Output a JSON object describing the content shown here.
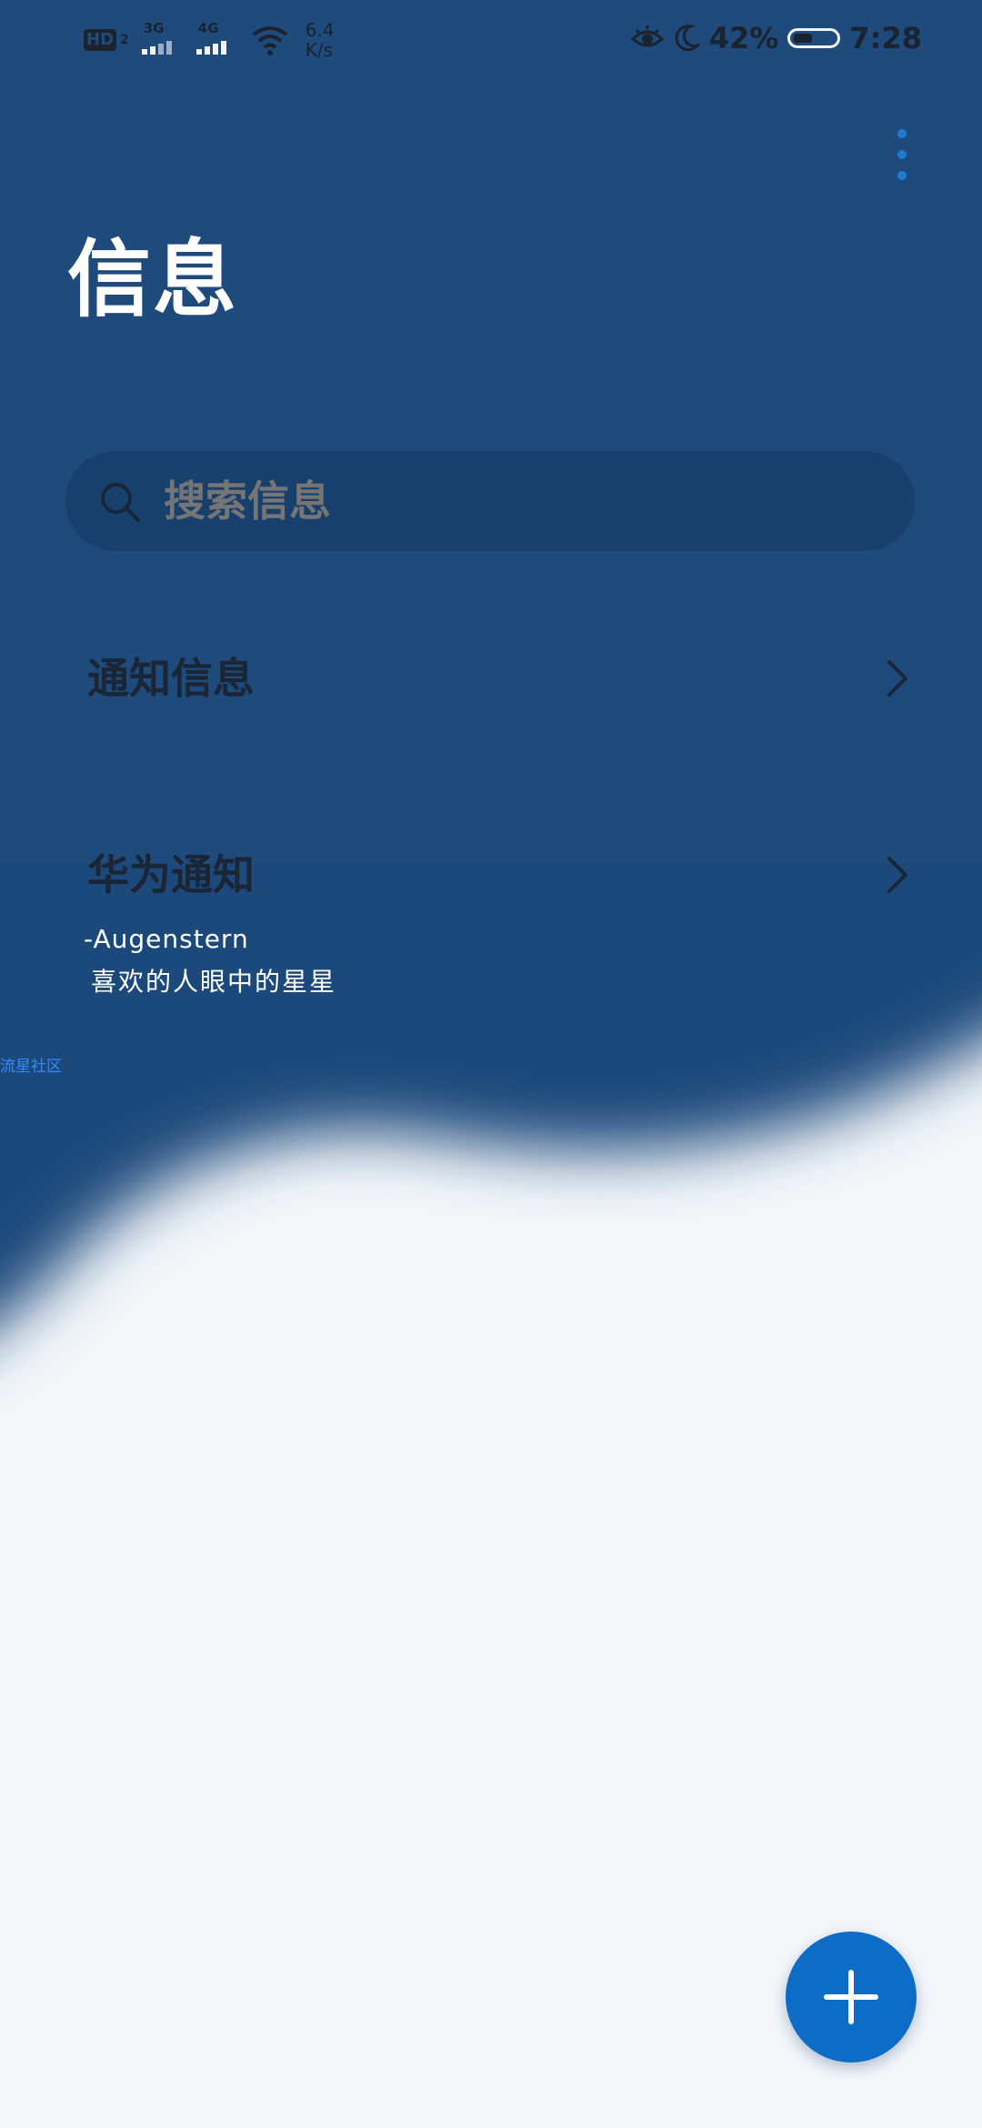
{
  "status_bar": {
    "hd_label": "HD",
    "hd_sub": "2",
    "signal_1_type": "3G",
    "signal_2_type": "4G",
    "net_speed_value": "6.4",
    "net_speed_unit": "K/s",
    "battery_percent": "42%",
    "time": "7:28",
    "icons": [
      "eye-comfort-icon",
      "moon-icon",
      "wifi-icon",
      "battery-icon"
    ]
  },
  "header": {
    "title": "信息",
    "menu_icon": "more-vertical-icon"
  },
  "search": {
    "placeholder": "搜索信息",
    "icon": "search-icon"
  },
  "list": {
    "items": [
      {
        "label": "通知信息",
        "icon": "chevron-right-icon"
      },
      {
        "label": "华为通知",
        "icon": "chevron-right-icon"
      }
    ]
  },
  "theme_signature": {
    "name": "-Augenstern",
    "quote": "喜欢的人眼中的星星"
  },
  "watermark": "流星社区",
  "fab": {
    "icon": "plus-icon"
  },
  "colors": {
    "background_dark": "#1E4A7C",
    "background_light": "#F4F6FA",
    "accent": "#0C6CC6",
    "title_text": "#FFFFFF",
    "list_text": "#1A2535"
  }
}
